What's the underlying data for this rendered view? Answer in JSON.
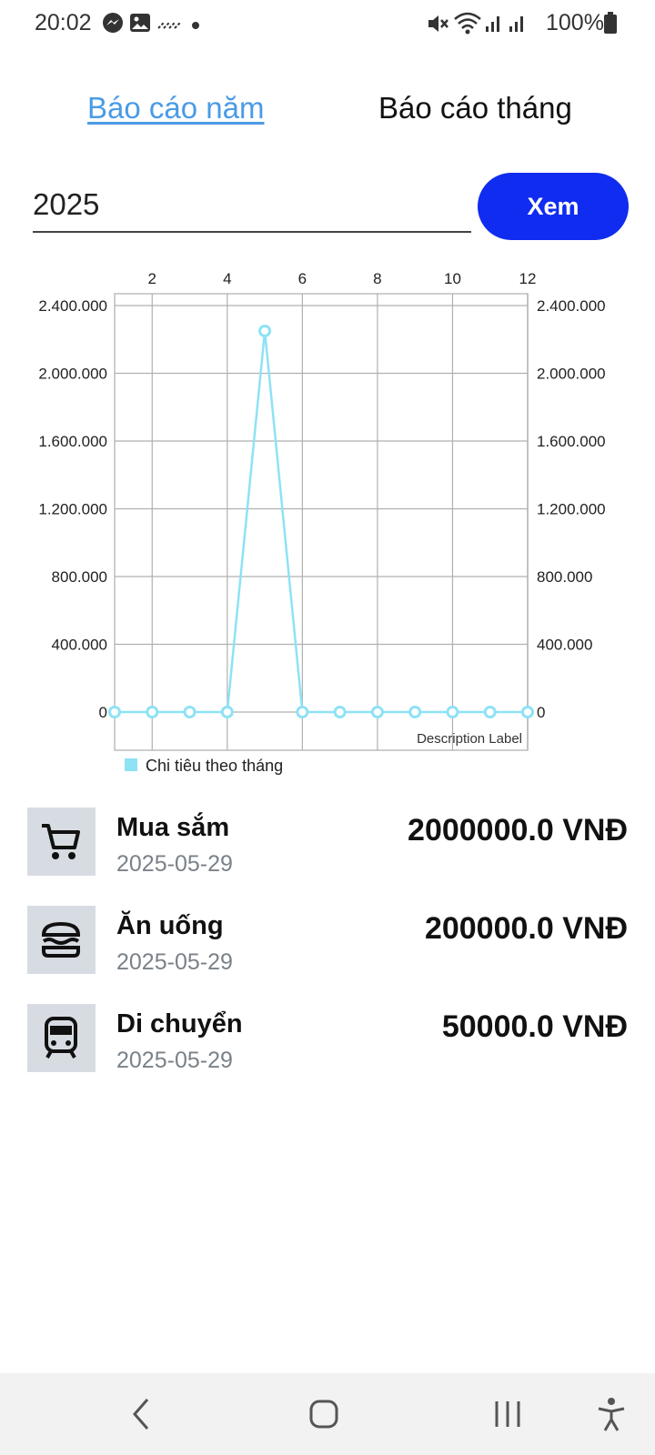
{
  "status_bar": {
    "time": "20:02",
    "battery": "100%",
    "left_icons": [
      "messenger-icon",
      "gallery-icon",
      "signal-activity-icon",
      "dot-icon"
    ],
    "right_icons": [
      "mute-icon",
      "wifi-icon",
      "signal-icon",
      "signal-icon",
      "battery-icon"
    ]
  },
  "tabs": {
    "year": "Báo cáo năm",
    "month": "Báo cáo tháng"
  },
  "year_input": {
    "value": "2025"
  },
  "view_button": {
    "label": "Xem"
  },
  "chart_data": {
    "type": "line",
    "x": [
      1,
      2,
      3,
      4,
      5,
      6,
      7,
      8,
      9,
      10,
      11,
      12
    ],
    "series": [
      {
        "name": "Chi tiêu theo tháng",
        "values": [
          0,
          0,
          0,
          0,
          2250000,
          0,
          0,
          0,
          0,
          0,
          0,
          0
        ],
        "color": "#8ee2f5"
      }
    ],
    "x_ticks": [
      "2",
      "4",
      "6",
      "8",
      "10",
      "12"
    ],
    "y_ticks": [
      "0",
      "400.000",
      "800.000",
      "1.200.000",
      "1.600.000",
      "2.000.000",
      "2.400.000"
    ],
    "xlim": [
      1,
      12
    ],
    "ylim": [
      0,
      2400000
    ],
    "description": "Description Label",
    "grid": true,
    "legend_position": "bottom-left"
  },
  "expenses": [
    {
      "name": "Mua sắm",
      "date": "2025-05-29",
      "amount": "2000000.0 VNĐ",
      "icon": "cart-icon"
    },
    {
      "name": "Ăn uống",
      "date": "2025-05-29",
      "amount": "200000.0 VNĐ",
      "icon": "burger-icon"
    },
    {
      "name": "Di chuyển",
      "date": "2025-05-29",
      "amount": "50000.0 VNĐ",
      "icon": "train-icon"
    }
  ],
  "nav": [
    "back-icon",
    "home-icon",
    "recents-icon",
    "accessibility-icon"
  ]
}
